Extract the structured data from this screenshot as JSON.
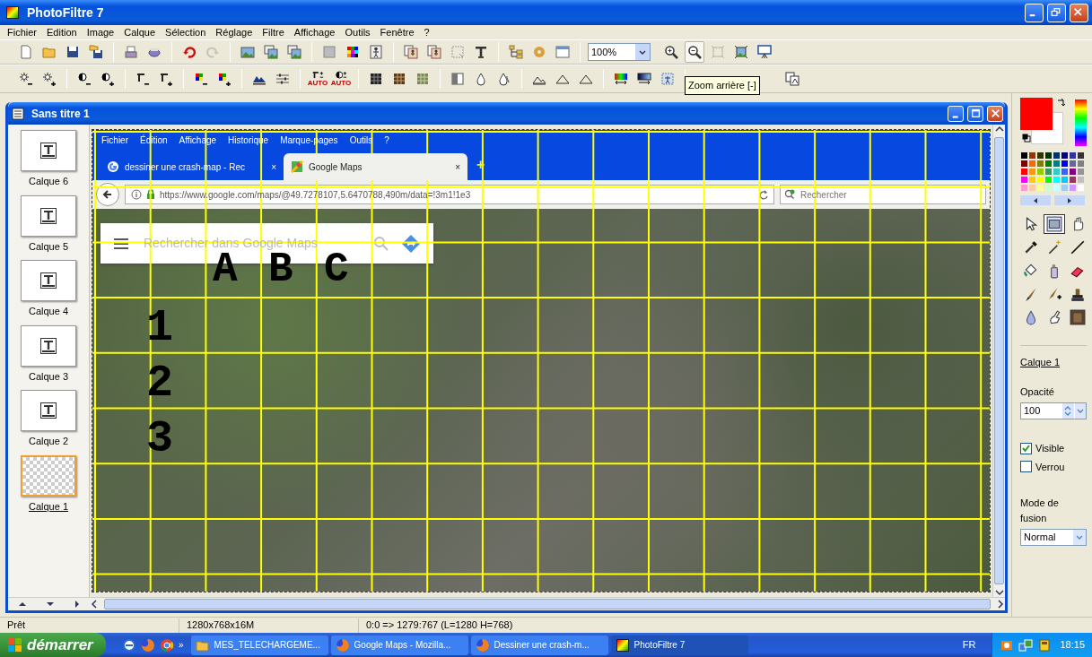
{
  "window": {
    "title": "PhotoFiltre 7"
  },
  "menu": [
    "Fichier",
    "Edition",
    "Image",
    "Calque",
    "Sélection",
    "Réglage",
    "Filtre",
    "Affichage",
    "Outils",
    "Fenêtre",
    "?"
  ],
  "toolbar_1": {
    "redo_disabled": true,
    "zoom_field": "100%",
    "zoom_out_hovered": true,
    "fit_disabled": true
  },
  "toolbar_2": {
    "auto_captions": [
      "AUTO",
      "AUTO"
    ],
    "tooltip": "Zoom arrière [-]"
  },
  "document": {
    "title": "Sans titre 1",
    "layers": [
      {
        "name": "Calque 6",
        "kind": "text",
        "selected": false
      },
      {
        "name": "Calque 5",
        "kind": "text",
        "selected": false
      },
      {
        "name": "Calque 4",
        "kind": "text",
        "selected": false
      },
      {
        "name": "Calque 3",
        "kind": "text",
        "selected": false
      },
      {
        "name": "Calque 2",
        "kind": "text",
        "selected": false
      },
      {
        "name": "Calque 1",
        "kind": "image",
        "selected": true
      }
    ],
    "image": {
      "browser_menu": [
        "Fichier",
        "Édition",
        "Affichage",
        "Historique",
        "Marque-pages",
        "Outils",
        "?"
      ],
      "tabs": [
        {
          "title": "dessiner une crash-map - Rec",
          "close": "×",
          "selected": false
        },
        {
          "title": "Google Maps",
          "close": "×",
          "selected": true
        }
      ],
      "new_tab": "+",
      "url": "https://www.google.com/maps/@49.7278107,5.6470788,490m/data=!3m1!1e3",
      "search_placeholder": "Rechercher",
      "map_search_placeholder": "Rechercher dans Google Maps",
      "column_labels": [
        "A",
        "B",
        "C"
      ],
      "row_labels": [
        "1",
        "2",
        "3"
      ]
    }
  },
  "colors": [
    {
      "kind": "foreground",
      "color": "#ff0000"
    },
    {
      "kind": "background",
      "color": "#ffffff"
    }
  ],
  "palette": [
    {
      "color": "#000000"
    },
    {
      "color": "#993300"
    },
    {
      "color": "#333300"
    },
    {
      "color": "#003300"
    },
    {
      "color": "#003366"
    },
    {
      "color": "#000080"
    },
    {
      "color": "#333399"
    },
    {
      "color": "#333333"
    },
    {
      "color": "#800000"
    },
    {
      "color": "#ff6600"
    },
    {
      "color": "#808000"
    },
    {
      "color": "#008000"
    },
    {
      "color": "#008080"
    },
    {
      "color": "#0000ff"
    },
    {
      "color": "#666699"
    },
    {
      "color": "#808080"
    },
    {
      "color": "#ff0000"
    },
    {
      "color": "#ff9900"
    },
    {
      "color": "#99cc00"
    },
    {
      "color": "#339966"
    },
    {
      "color": "#33cccc"
    },
    {
      "color": "#3366ff"
    },
    {
      "color": "#800080"
    },
    {
      "color": "#969696"
    },
    {
      "color": "#ff00ff"
    },
    {
      "color": "#ffcc00"
    },
    {
      "color": "#ffff00"
    },
    {
      "color": "#00ff00"
    },
    {
      "color": "#00ffff"
    },
    {
      "color": "#00ccff"
    },
    {
      "color": "#993366"
    },
    {
      "color": "#c0c0c0"
    },
    {
      "color": "#ff99cc"
    },
    {
      "color": "#ffcc99"
    },
    {
      "color": "#ffff99"
    },
    {
      "color": "#ccffcc"
    },
    {
      "color": "#ccffff"
    },
    {
      "color": "#99ccff"
    },
    {
      "color": "#cc99ff"
    },
    {
      "color": "#ffffff"
    }
  ],
  "tools": [
    {
      "kind": "pointer",
      "selected": false
    },
    {
      "kind": "selection",
      "selected": true
    },
    {
      "kind": "hand",
      "selected": false
    },
    {
      "kind": "eyedropper",
      "selected": false
    },
    {
      "kind": "wand",
      "selected": false
    },
    {
      "kind": "line",
      "selected": false
    },
    {
      "kind": "bucket",
      "selected": false
    },
    {
      "kind": "spray",
      "selected": false
    },
    {
      "kind": "eraser",
      "selected": false
    },
    {
      "kind": "brush",
      "selected": false
    },
    {
      "kind": "brushplus",
      "selected": false
    },
    {
      "kind": "stamp",
      "selected": false
    },
    {
      "kind": "drop",
      "selected": false
    },
    {
      "kind": "finger",
      "selected": false
    },
    {
      "kind": "picture",
      "selected": false
    }
  ],
  "layer_properties": {
    "name": "Calque 1",
    "opacity_label": "Opacité",
    "opacity": "100",
    "options": [
      {
        "label": "Visible",
        "checked": true
      },
      {
        "label": "Verrou",
        "checked": false
      }
    ],
    "blend_label": "Mode de fusion",
    "blend_mode": "Normal"
  },
  "status_bar": [
    "Prêt",
    "1280x768x16M",
    "0:0 => 1279:767 (L=1280 H=768)"
  ],
  "taskbar": {
    "start": "démarrer",
    "more": "»",
    "tasks": [
      {
        "label": "MES_TELECHARGEME...",
        "kind": "folder",
        "selected": false
      },
      {
        "label": "Google Maps - Mozilla...",
        "kind": "browser",
        "selected": false
      },
      {
        "label": "Dessiner une crash-m...",
        "kind": "browser",
        "selected": false
      },
      {
        "label": "PhotoFiltre 7",
        "kind": "app",
        "selected": true
      }
    ],
    "language": "FR",
    "clock": "18:15"
  }
}
